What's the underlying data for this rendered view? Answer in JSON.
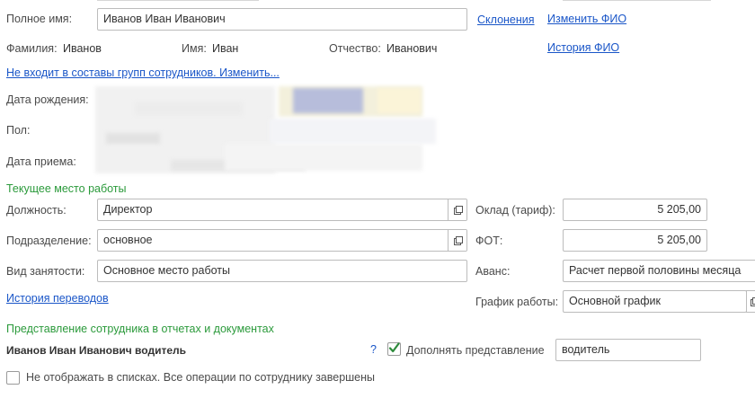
{
  "employee": {
    "full_name_label": "Полное имя:",
    "full_name_value": "Иванов Иван Иванович",
    "declensions_link": "Склонения",
    "change_fio_link": "Изменить ФИО",
    "fio_history_link": "История ФИО",
    "surname_label": "Фамилия:",
    "surname_value": "Иванов",
    "name_label": "Имя:",
    "name_value": "Иван",
    "patronymic_label": "Отчество:",
    "patronymic_value": "Иванович",
    "groups_link": "Не входит в составы групп сотрудников. Изменить...",
    "birth_date_label": "Дата рождения:",
    "gender_label": "Пол:",
    "hire_date_label": "Дата приема:"
  },
  "workplace": {
    "section_title": "Текущее место работы",
    "position_label": "Должность:",
    "position_value": "Директор",
    "department_label": "Подразделение:",
    "department_value": "основное",
    "employment_type_label": "Вид занятости:",
    "employment_type_value": "Основное место работы",
    "transfer_history_link": "История переводов",
    "salary_label": "Оклад (тариф):",
    "salary_value": "5 205,00",
    "payroll_label": "ФОТ:",
    "payroll_value": "5 205,00",
    "advance_label": "Аванс:",
    "advance_value": "Расчет первой половины месяца",
    "schedule_label": "График работы:",
    "schedule_value": "Основной график"
  },
  "presentation": {
    "section_title": "Представление сотрудника в отчетах и документах",
    "display_name": "Иванов Иван Иванович водитель",
    "help_mark": "?",
    "supplement_label": "Дополнять представление",
    "supplement_checked": true,
    "supplement_value": "водитель",
    "hide_in_lists_label": "Не отображать в списках. Все операции по сотруднику завершены",
    "hide_in_lists_checked": false
  },
  "colors": {
    "link": "#1a56c8",
    "section": "#2b9a3b",
    "check": "#2e8b3c"
  }
}
